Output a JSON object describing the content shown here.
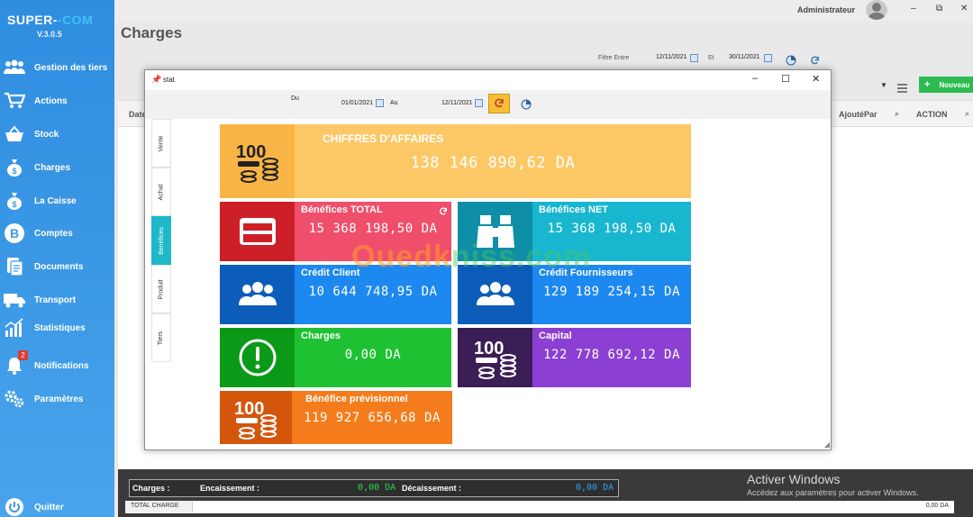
{
  "app": {
    "brand_part1": "SUPER-",
    "brand_part2": "-COM",
    "version": "V.3.0.5",
    "user": "Administrateur",
    "page_title": "Charges"
  },
  "sidebar": {
    "items": [
      {
        "label": "Gestion des tiers",
        "icon": "users-icon"
      },
      {
        "label": "Actions",
        "icon": "cart-icon"
      },
      {
        "label": "Stock",
        "icon": "basket-icon"
      },
      {
        "label": "Charges",
        "icon": "money-bag-icon"
      },
      {
        "label": "La Caisse",
        "icon": "money-bag-icon"
      },
      {
        "label": "Comptes",
        "icon": "bitcoin-icon"
      },
      {
        "label": "Documents",
        "icon": "documents-icon"
      },
      {
        "label": "Transport",
        "icon": "truck-icon"
      },
      {
        "label": "Statistiques",
        "icon": "chart-icon"
      },
      {
        "label": "Notifications",
        "icon": "bell-icon",
        "badge": "2"
      },
      {
        "label": "Paramètres",
        "icon": "gears-icon"
      },
      {
        "label": "Quitter",
        "icon": "power-icon"
      }
    ]
  },
  "filter": {
    "label_from": "Filtre Entre",
    "from": "12/11/2021",
    "label_and": "Et",
    "to": "30/11/2021"
  },
  "toolbar": {
    "nouveau": "Nouveau"
  },
  "table": {
    "col_date": "Date",
    "col_ajoute": "AjoutéPar",
    "col_action": "ACTION"
  },
  "bottom": {
    "charges_label": "Charges :",
    "encaissement_label": "Encaissement :",
    "encaissement_value": "0,00 DA",
    "decaissement_label": "Décaissement :",
    "decaissement_value": "0,00 DA",
    "total_label": "TOTAL CHARGE",
    "total_value": "0,00 DA"
  },
  "windows_notice": {
    "line1": "Activer Windows",
    "line2": "Accédez aux paramètres pour activer Windows."
  },
  "dialog": {
    "title": "stat",
    "label_du": "Du",
    "date_du": "01/01/2021",
    "label_au": "Au",
    "date_au": "12/11/2021",
    "tabs": [
      "Vente",
      "Achat",
      "Benéfices",
      "Produit",
      "Tiers"
    ],
    "active_tab": "Benéfices",
    "watermark": {
      "part1": "Ouedk",
      "part2": "niss.com"
    },
    "tiles": {
      "ca": {
        "title": "CHIFFRES D'AFFAIRES",
        "value": "138 146 890,62 DA",
        "color": "#fcc866"
      },
      "benefices_total": {
        "title": "Bénéfices TOTAL",
        "value": "15 368 198,50 DA",
        "color": "#ef4f6b"
      },
      "benefices_net": {
        "title": "Bénéfices NET",
        "value": "15 368 198,50 DA",
        "color": "#18b7cf"
      },
      "credit_client": {
        "title": "Crédit Client",
        "value": "10 644 748,95 DA",
        "color": "#1d88ef"
      },
      "credit_fournisseurs": {
        "title": "Crédit Fournisseurs",
        "value": "129 189 254,15 DA",
        "color": "#1d88ef"
      },
      "charges": {
        "title": "Charges",
        "value": "0,00 DA",
        "color": "#1ec132"
      },
      "capital": {
        "title": "Capital",
        "value": "122 778 692,12 DA",
        "color": "#8b3fd3"
      },
      "benefice_previsionnel": {
        "title": "Bénéfice prévisionnel",
        "value": "119 927 656,68 DA",
        "color": "#f47c1c"
      }
    }
  }
}
